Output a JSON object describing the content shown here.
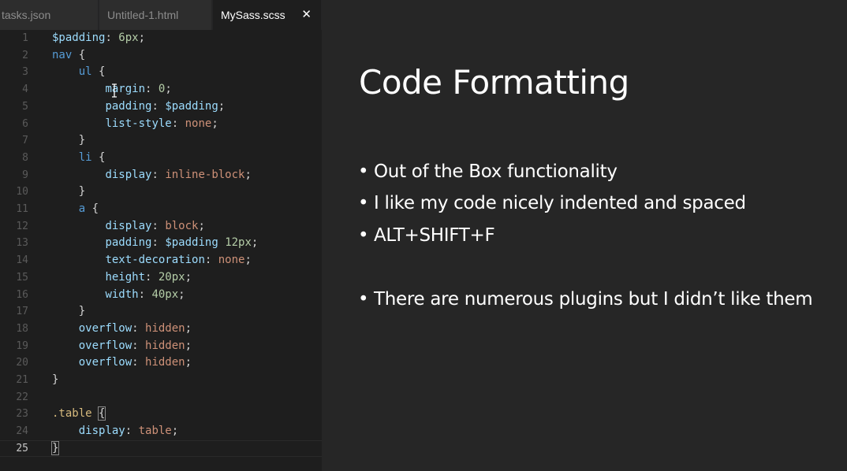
{
  "editor": {
    "tabs": [
      {
        "label": "tasks.json"
      },
      {
        "label": "Untitled-1.html"
      },
      {
        "label": "MySass.scss",
        "close": "✕"
      }
    ],
    "lines": [
      {
        "n": "1",
        "tokens": [
          [
            "var",
            "$padding"
          ],
          [
            "punc",
            ": "
          ],
          [
            "num",
            "6px"
          ],
          [
            "punc",
            ";"
          ]
        ]
      },
      {
        "n": "2",
        "tokens": [
          [
            "tag",
            "nav"
          ],
          [
            "punc",
            " {"
          ]
        ]
      },
      {
        "n": "3",
        "tokens": [
          [
            "punc",
            "    "
          ],
          [
            "tag",
            "ul"
          ],
          [
            "punc",
            " {"
          ]
        ]
      },
      {
        "n": "4",
        "tokens": [
          [
            "punc",
            "        "
          ],
          [
            "prop",
            "margin"
          ],
          [
            "punc",
            ": "
          ],
          [
            "num",
            "0"
          ],
          [
            "punc",
            ";"
          ]
        ]
      },
      {
        "n": "5",
        "tokens": [
          [
            "punc",
            "        "
          ],
          [
            "prop",
            "padding"
          ],
          [
            "punc",
            ": "
          ],
          [
            "var",
            "$padding"
          ],
          [
            "punc",
            ";"
          ]
        ]
      },
      {
        "n": "6",
        "tokens": [
          [
            "punc",
            "        "
          ],
          [
            "prop",
            "list-style"
          ],
          [
            "punc",
            ": "
          ],
          [
            "val",
            "none"
          ],
          [
            "punc",
            ";"
          ]
        ]
      },
      {
        "n": "7",
        "tokens": [
          [
            "punc",
            "    }"
          ]
        ]
      },
      {
        "n": "8",
        "tokens": [
          [
            "punc",
            "    "
          ],
          [
            "tag",
            "li"
          ],
          [
            "punc",
            " {"
          ]
        ]
      },
      {
        "n": "9",
        "tokens": [
          [
            "punc",
            "        "
          ],
          [
            "prop",
            "display"
          ],
          [
            "punc",
            ": "
          ],
          [
            "val",
            "inline-block"
          ],
          [
            "punc",
            ";"
          ]
        ]
      },
      {
        "n": "10",
        "tokens": [
          [
            "punc",
            "    }"
          ]
        ]
      },
      {
        "n": "11",
        "tokens": [
          [
            "punc",
            "    "
          ],
          [
            "tag",
            "a"
          ],
          [
            "punc",
            " {"
          ]
        ]
      },
      {
        "n": "12",
        "tokens": [
          [
            "punc",
            "        "
          ],
          [
            "prop",
            "display"
          ],
          [
            "punc",
            ": "
          ],
          [
            "val",
            "block"
          ],
          [
            "punc",
            ";"
          ]
        ]
      },
      {
        "n": "13",
        "tokens": [
          [
            "punc",
            "        "
          ],
          [
            "prop",
            "padding"
          ],
          [
            "punc",
            ": "
          ],
          [
            "var",
            "$padding"
          ],
          [
            "punc",
            " "
          ],
          [
            "num",
            "12px"
          ],
          [
            "punc",
            ";"
          ]
        ]
      },
      {
        "n": "14",
        "tokens": [
          [
            "punc",
            "        "
          ],
          [
            "prop",
            "text-decoration"
          ],
          [
            "punc",
            ": "
          ],
          [
            "val",
            "none"
          ],
          [
            "punc",
            ";"
          ]
        ]
      },
      {
        "n": "15",
        "tokens": [
          [
            "punc",
            "        "
          ],
          [
            "prop",
            "height"
          ],
          [
            "punc",
            ": "
          ],
          [
            "num",
            "20px"
          ],
          [
            "punc",
            ";"
          ]
        ]
      },
      {
        "n": "16",
        "tokens": [
          [
            "punc",
            "        "
          ],
          [
            "prop",
            "width"
          ],
          [
            "punc",
            ": "
          ],
          [
            "num",
            "40px"
          ],
          [
            "punc",
            ";"
          ]
        ]
      },
      {
        "n": "17",
        "tokens": [
          [
            "punc",
            "    }"
          ]
        ]
      },
      {
        "n": "18",
        "tokens": [
          [
            "punc",
            "    "
          ],
          [
            "prop",
            "overflow"
          ],
          [
            "punc",
            ": "
          ],
          [
            "val",
            "hidden"
          ],
          [
            "punc",
            ";"
          ]
        ]
      },
      {
        "n": "19",
        "tokens": [
          [
            "punc",
            "    "
          ],
          [
            "prop",
            "overflow"
          ],
          [
            "punc",
            ": "
          ],
          [
            "val",
            "hidden"
          ],
          [
            "punc",
            ";"
          ]
        ]
      },
      {
        "n": "20",
        "tokens": [
          [
            "punc",
            "    "
          ],
          [
            "prop",
            "overflow"
          ],
          [
            "punc",
            ": "
          ],
          [
            "val",
            "hidden"
          ],
          [
            "punc",
            ";"
          ]
        ]
      },
      {
        "n": "21",
        "tokens": [
          [
            "punc",
            "}"
          ]
        ]
      },
      {
        "n": "22",
        "tokens": []
      },
      {
        "n": "23",
        "tokens": [
          [
            "sel",
            ".table"
          ],
          [
            "punc",
            " "
          ],
          [
            "box",
            "{"
          ]
        ]
      },
      {
        "n": "24",
        "tokens": [
          [
            "punc",
            "    "
          ],
          [
            "prop",
            "display"
          ],
          [
            "punc",
            ": "
          ],
          [
            "val",
            "table"
          ],
          [
            "punc",
            ";"
          ]
        ]
      },
      {
        "n": "25",
        "tokens": [
          [
            "box",
            "}"
          ]
        ],
        "active": true
      }
    ]
  },
  "slide": {
    "title": "Code Formatting",
    "bullets": [
      "Out of the Box functionality",
      "I like my code nicely indented and spaced",
      "ALT+SHIFT+F",
      "There are numerous plugins but I didn’t like them"
    ],
    "bullet_symbol": "•"
  },
  "colors": {
    "editor_bg": "#1e1e1e",
    "slide_bg": "#262626",
    "variable": "#9cdcfe",
    "keyword_tag": "#569cd6",
    "number": "#b5cea8",
    "string_value": "#ce9178",
    "selector": "#d7ba7d"
  }
}
